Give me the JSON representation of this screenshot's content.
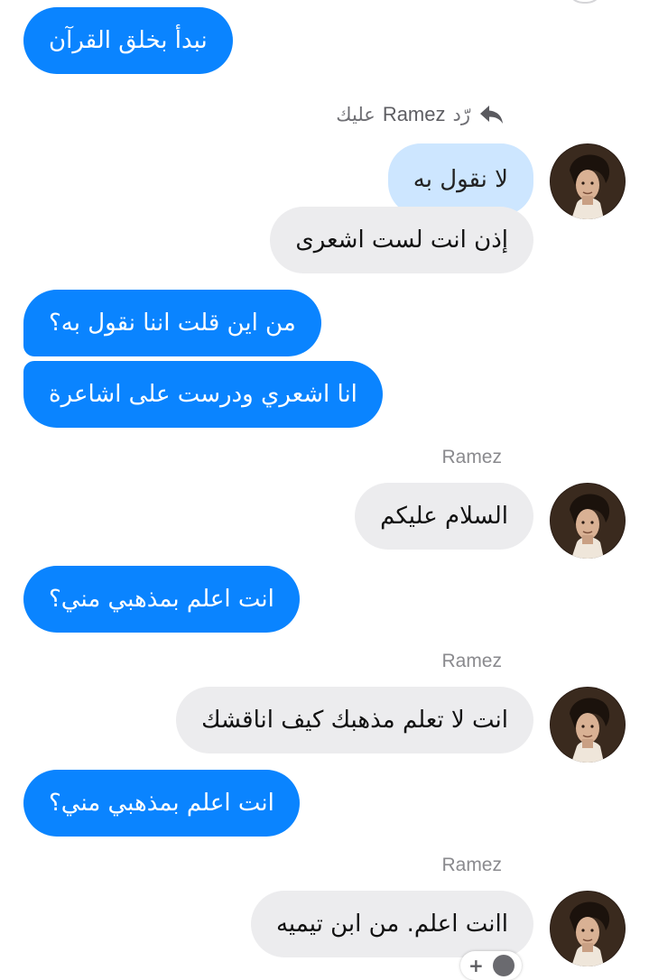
{
  "messages": {
    "m1": "نبدأ بخلق القرآن",
    "reply_header": {
      "prefix": "رّد",
      "name": "Ramez",
      "suffix": "عليك",
      "icon": "reply-arrow-icon"
    },
    "m2_quoted": "لا نقول به",
    "m3": "إذن انت لست اشعرى",
    "m4": "من اين قلت اننا نقول به؟",
    "m5": "انا اشعري ودرست على اشاعرة",
    "sender_1": "Ramez",
    "m6": "السلام عليكم",
    "m7": "انت اعلم بمذهبي مني؟",
    "sender_2": "Ramez",
    "m8": "انت لا تعلم مذهبك كيف اناقشك",
    "m9": "انت اعلم بمذهبي مني؟",
    "sender_3": "Ramez",
    "m10": "اانت اعلم. من ابن تيميه"
  },
  "colors": {
    "outgoing_bubble": "#0a84ff",
    "incoming_bubble": "#ececee",
    "quoted_bubble": "#cde6ff",
    "sender_name": "#8a8a8e"
  },
  "icons": {
    "avatar": "contact-avatar-photo",
    "reaction": "add-reaction-icon"
  }
}
